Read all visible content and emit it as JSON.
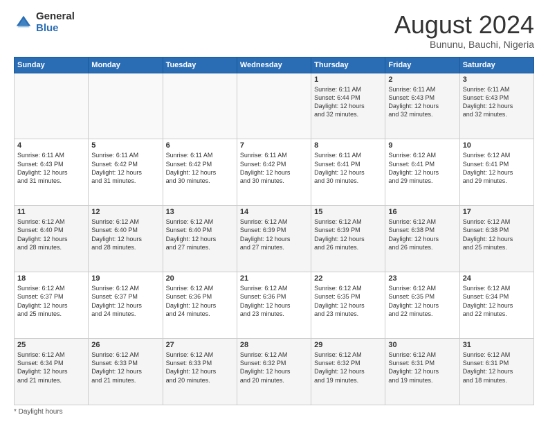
{
  "logo": {
    "general": "General",
    "blue": "Blue"
  },
  "header": {
    "title": "August 2024",
    "subtitle": "Bununu, Bauchi, Nigeria"
  },
  "calendar": {
    "weekdays": [
      "Sunday",
      "Monday",
      "Tuesday",
      "Wednesday",
      "Thursday",
      "Friday",
      "Saturday"
    ],
    "weeks": [
      [
        {
          "day": "",
          "info": ""
        },
        {
          "day": "",
          "info": ""
        },
        {
          "day": "",
          "info": ""
        },
        {
          "day": "",
          "info": ""
        },
        {
          "day": "1",
          "info": "Sunrise: 6:11 AM\nSunset: 6:44 PM\nDaylight: 12 hours\nand 32 minutes."
        },
        {
          "day": "2",
          "info": "Sunrise: 6:11 AM\nSunset: 6:43 PM\nDaylight: 12 hours\nand 32 minutes."
        },
        {
          "day": "3",
          "info": "Sunrise: 6:11 AM\nSunset: 6:43 PM\nDaylight: 12 hours\nand 32 minutes."
        }
      ],
      [
        {
          "day": "4",
          "info": "Sunrise: 6:11 AM\nSunset: 6:43 PM\nDaylight: 12 hours\nand 31 minutes."
        },
        {
          "day": "5",
          "info": "Sunrise: 6:11 AM\nSunset: 6:42 PM\nDaylight: 12 hours\nand 31 minutes."
        },
        {
          "day": "6",
          "info": "Sunrise: 6:11 AM\nSunset: 6:42 PM\nDaylight: 12 hours\nand 30 minutes."
        },
        {
          "day": "7",
          "info": "Sunrise: 6:11 AM\nSunset: 6:42 PM\nDaylight: 12 hours\nand 30 minutes."
        },
        {
          "day": "8",
          "info": "Sunrise: 6:11 AM\nSunset: 6:41 PM\nDaylight: 12 hours\nand 30 minutes."
        },
        {
          "day": "9",
          "info": "Sunrise: 6:12 AM\nSunset: 6:41 PM\nDaylight: 12 hours\nand 29 minutes."
        },
        {
          "day": "10",
          "info": "Sunrise: 6:12 AM\nSunset: 6:41 PM\nDaylight: 12 hours\nand 29 minutes."
        }
      ],
      [
        {
          "day": "11",
          "info": "Sunrise: 6:12 AM\nSunset: 6:40 PM\nDaylight: 12 hours\nand 28 minutes."
        },
        {
          "day": "12",
          "info": "Sunrise: 6:12 AM\nSunset: 6:40 PM\nDaylight: 12 hours\nand 28 minutes."
        },
        {
          "day": "13",
          "info": "Sunrise: 6:12 AM\nSunset: 6:40 PM\nDaylight: 12 hours\nand 27 minutes."
        },
        {
          "day": "14",
          "info": "Sunrise: 6:12 AM\nSunset: 6:39 PM\nDaylight: 12 hours\nand 27 minutes."
        },
        {
          "day": "15",
          "info": "Sunrise: 6:12 AM\nSunset: 6:39 PM\nDaylight: 12 hours\nand 26 minutes."
        },
        {
          "day": "16",
          "info": "Sunrise: 6:12 AM\nSunset: 6:38 PM\nDaylight: 12 hours\nand 26 minutes."
        },
        {
          "day": "17",
          "info": "Sunrise: 6:12 AM\nSunset: 6:38 PM\nDaylight: 12 hours\nand 25 minutes."
        }
      ],
      [
        {
          "day": "18",
          "info": "Sunrise: 6:12 AM\nSunset: 6:37 PM\nDaylight: 12 hours\nand 25 minutes."
        },
        {
          "day": "19",
          "info": "Sunrise: 6:12 AM\nSunset: 6:37 PM\nDaylight: 12 hours\nand 24 minutes."
        },
        {
          "day": "20",
          "info": "Sunrise: 6:12 AM\nSunset: 6:36 PM\nDaylight: 12 hours\nand 24 minutes."
        },
        {
          "day": "21",
          "info": "Sunrise: 6:12 AM\nSunset: 6:36 PM\nDaylight: 12 hours\nand 23 minutes."
        },
        {
          "day": "22",
          "info": "Sunrise: 6:12 AM\nSunset: 6:35 PM\nDaylight: 12 hours\nand 23 minutes."
        },
        {
          "day": "23",
          "info": "Sunrise: 6:12 AM\nSunset: 6:35 PM\nDaylight: 12 hours\nand 22 minutes."
        },
        {
          "day": "24",
          "info": "Sunrise: 6:12 AM\nSunset: 6:34 PM\nDaylight: 12 hours\nand 22 minutes."
        }
      ],
      [
        {
          "day": "25",
          "info": "Sunrise: 6:12 AM\nSunset: 6:34 PM\nDaylight: 12 hours\nand 21 minutes."
        },
        {
          "day": "26",
          "info": "Sunrise: 6:12 AM\nSunset: 6:33 PM\nDaylight: 12 hours\nand 21 minutes."
        },
        {
          "day": "27",
          "info": "Sunrise: 6:12 AM\nSunset: 6:33 PM\nDaylight: 12 hours\nand 20 minutes."
        },
        {
          "day": "28",
          "info": "Sunrise: 6:12 AM\nSunset: 6:32 PM\nDaylight: 12 hours\nand 20 minutes."
        },
        {
          "day": "29",
          "info": "Sunrise: 6:12 AM\nSunset: 6:32 PM\nDaylight: 12 hours\nand 19 minutes."
        },
        {
          "day": "30",
          "info": "Sunrise: 6:12 AM\nSunset: 6:31 PM\nDaylight: 12 hours\nand 19 minutes."
        },
        {
          "day": "31",
          "info": "Sunrise: 6:12 AM\nSunset: 6:31 PM\nDaylight: 12 hours\nand 18 minutes."
        }
      ]
    ]
  },
  "footer": {
    "note": "Daylight hours"
  }
}
